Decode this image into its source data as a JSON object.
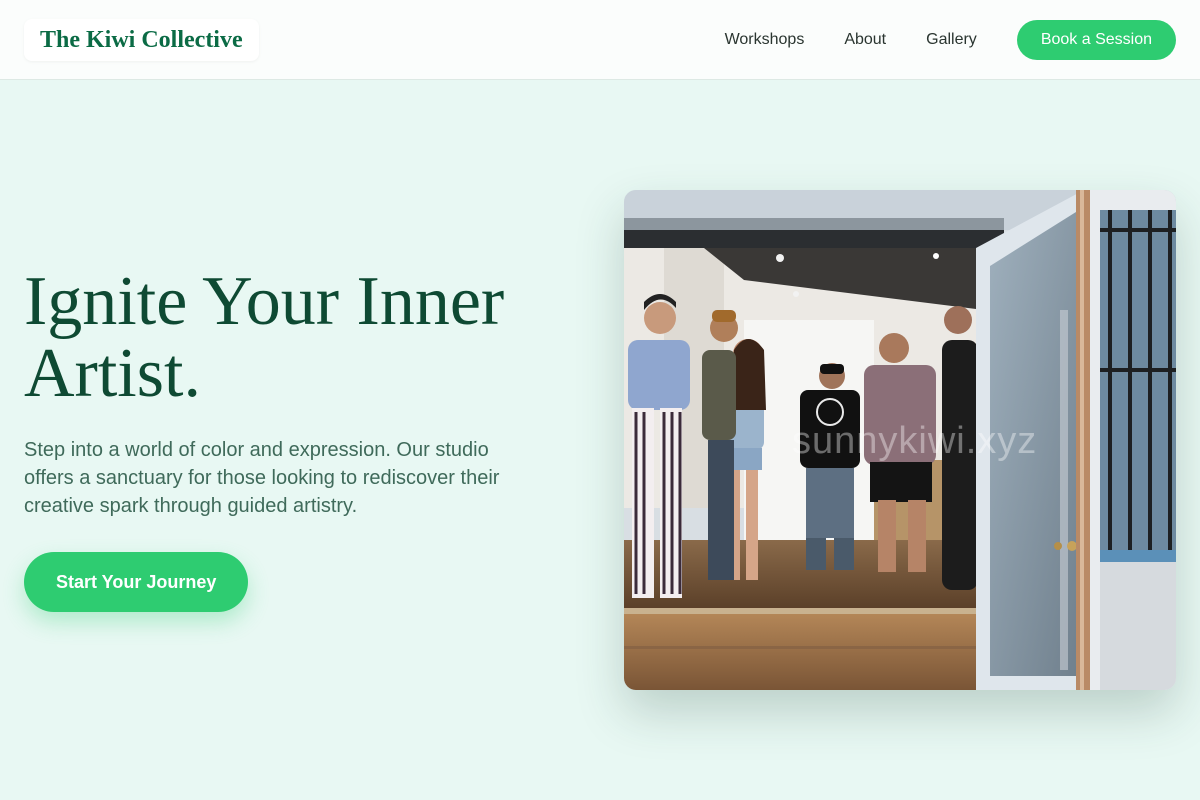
{
  "header": {
    "logo": "The Kiwi Collective",
    "nav": [
      "Workshops",
      "About",
      "Gallery"
    ],
    "cta_label": "Book a Session"
  },
  "hero": {
    "title": "Ignite Your Inner Artist.",
    "subtitle": "Step into a world of color and expression. Our studio offers a sanctuary for those looking to rediscover their creative spark through guided artistry.",
    "cta_label": "Start Your Journey",
    "image": {
      "subject": "people gathered inside an art gallery viewed through an open glass door",
      "watermark": "sunnykiwi.xyz"
    }
  },
  "theme": {
    "accent": "#2ecc71",
    "brand": "#0b6b45",
    "heading": "#0e4a33",
    "body_text": "#3f6a5a",
    "page_background": "#e8f8f3"
  }
}
